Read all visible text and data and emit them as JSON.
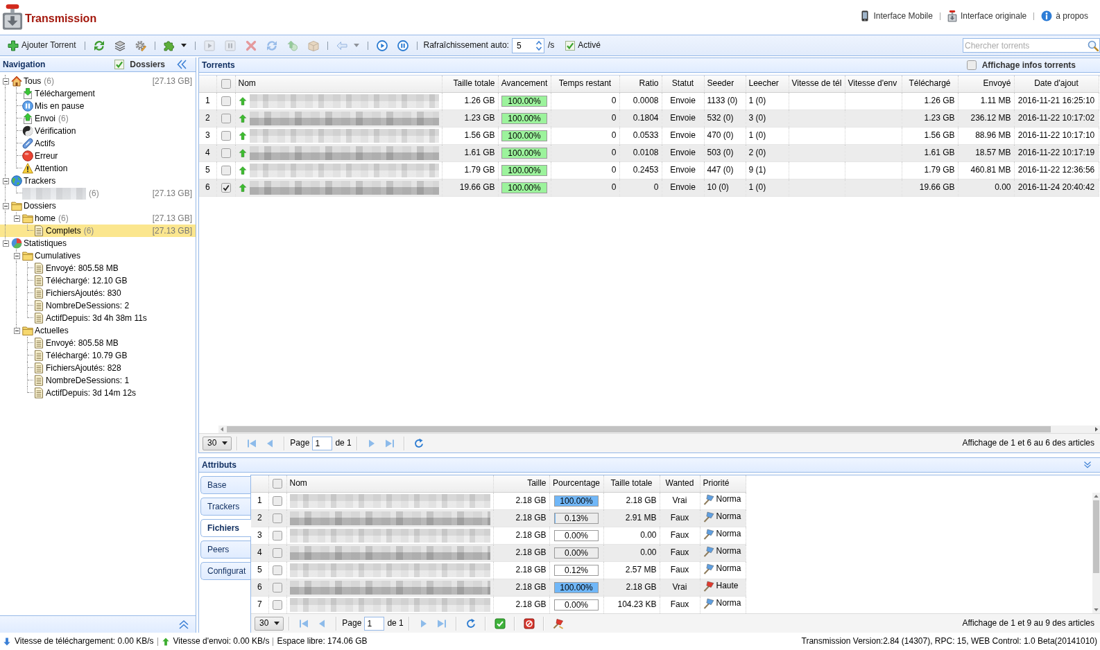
{
  "header": {
    "title": "Transmission",
    "links": [
      "Interface Mobile",
      "Interface originale",
      "à propos"
    ]
  },
  "toolbar": {
    "groups": [
      [
        {
          "kind": "button",
          "label": "Ajouter Torrent",
          "disabled": false
        }
      ],
      [
        {
          "kind": "button",
          "disabled": false
        },
        {
          "kind": "button",
          "disabled": false
        },
        {
          "kind": "button",
          "disabled": false
        }
      ],
      [
        {
          "kind": "dropdown",
          "disabled": false
        }
      ],
      [
        {
          "kind": "button",
          "disabled": true
        },
        {
          "kind": "button",
          "disabled": true
        },
        {
          "kind": "button",
          "disabled": true
        },
        {
          "kind": "button",
          "disabled": true
        },
        {
          "kind": "button",
          "disabled": true
        },
        {
          "kind": "button",
          "disabled": true
        }
      ],
      [
        {
          "kind": "dropdown",
          "disabled": true
        }
      ],
      [
        {
          "kind": "button",
          "disabled": false
        },
        {
          "kind": "button",
          "disabled": false
        }
      ]
    ],
    "refresh": {
      "label": "Rafraîchissement auto:",
      "value": "5",
      "unit": "/s"
    },
    "auto_refresh": {
      "label": "Activé",
      "checked": true
    },
    "search": {
      "placeholder": "Chercher torrents"
    }
  },
  "navigation": {
    "title": "Navigation",
    "folders_toggle": {
      "label": "Dossiers",
      "checked": true
    },
    "tree": [
      {
        "kind": "all",
        "label": "Tous",
        "count": "(6)",
        "size": "[27.13 GB]",
        "expanded": true,
        "selected": false,
        "children": [
          {
            "kind": "downloading",
            "label": "Téléchargement",
            "selected": false
          },
          {
            "kind": "paused",
            "label": "Mis en pause",
            "selected": false
          },
          {
            "kind": "seeding",
            "label": "Envoi",
            "count": "(6)",
            "selected": false
          },
          {
            "kind": "checking",
            "label": "Vérification",
            "selected": false
          },
          {
            "kind": "active",
            "label": "Actifs",
            "selected": false
          },
          {
            "kind": "error",
            "label": "Erreur",
            "selected": false
          },
          {
            "kind": "warning",
            "label": "Attention",
            "selected": false
          }
        ]
      },
      {
        "kind": "trackers",
        "label": "Trackers",
        "expanded": true,
        "selected": false,
        "children": [
          {
            "kind": "tracker",
            "count": "(6)",
            "size": "[27.13 GB]",
            "selected": false
          }
        ]
      },
      {
        "kind": "folder",
        "label": "Dossiers",
        "expanded": true,
        "selected": false,
        "children": [
          {
            "kind": "folder",
            "label": "home",
            "count": "(6)",
            "size": "[27.13 GB]",
            "expanded": true,
            "selected": false,
            "children": [
              {
                "kind": "file",
                "label": "Complets",
                "count": "(6)",
                "size": "[27.13 GB]",
                "selected": true
              }
            ]
          }
        ]
      },
      {
        "kind": "statistics",
        "label": "Statistiques",
        "expanded": true,
        "selected": false,
        "children": [
          {
            "kind": "folder",
            "label": "Cumulatives",
            "expanded": true,
            "selected": false,
            "children": [
              {
                "kind": "file",
                "label": "Envoyé: 805.58 MB",
                "selected": false
              },
              {
                "kind": "file",
                "label": "Téléchargé: 12.10 GB",
                "selected": false
              },
              {
                "kind": "file",
                "label": "FichiersAjoutés: 830",
                "selected": false
              },
              {
                "kind": "file",
                "label": "NombreDeSessions: 2",
                "selected": false
              },
              {
                "kind": "file",
                "label": "ActifDepuis: 3d 4h 38m 11s",
                "selected": false
              }
            ]
          },
          {
            "kind": "folder",
            "label": "Actuelles",
            "expanded": true,
            "selected": false,
            "children": [
              {
                "kind": "file",
                "label": "Envoyé: 805.58 MB",
                "selected": false
              },
              {
                "kind": "file",
                "label": "Téléchargé: 10.79 GB",
                "selected": false
              },
              {
                "kind": "file",
                "label": "FichiersAjoutés: 828",
                "selected": false
              },
              {
                "kind": "file",
                "label": "NombreDeSessions: 1",
                "selected": false
              },
              {
                "kind": "file",
                "label": "ActifDepuis: 3d 14m 12s",
                "selected": false
              }
            ]
          }
        ]
      }
    ]
  },
  "torrents": {
    "title": "Torrents",
    "info_toggle": {
      "label": "Affichage infos torrents",
      "checked": false
    },
    "columns": [
      "Nom",
      "Taille totale",
      "Avancement",
      "Temps restant",
      "Ratio",
      "Statut",
      "Seeder",
      "Leecher",
      "Vitesse de tél",
      "Vitesse d'env",
      "Téléchargé",
      "Envoyé",
      "Date d'ajout"
    ],
    "select_all": false,
    "rows": [
      {
        "number": "1",
        "checked": false,
        "size": "1.26 GB",
        "progress": "100.00%",
        "level": 1,
        "remaining": "0",
        "ratio": "0.0008",
        "status": "Envoie",
        "seeder": "1133 (0)",
        "leecher": "1 (0)",
        "downloaded": "1.26 GB",
        "uploaded": "1.11 MB",
        "added": "2016-11-21 16:25:10"
      },
      {
        "number": "2",
        "checked": false,
        "size": "1.23 GB",
        "progress": "100.00%",
        "level": 1,
        "remaining": "0",
        "ratio": "0.1804",
        "status": "Envoie",
        "seeder": "532 (0)",
        "leecher": "3 (0)",
        "downloaded": "1.23 GB",
        "uploaded": "236.12 MB",
        "added": "2016-11-22 10:17:02"
      },
      {
        "number": "3",
        "checked": false,
        "size": "1.56 GB",
        "progress": "100.00%",
        "level": 1,
        "remaining": "0",
        "ratio": "0.0533",
        "status": "Envoie",
        "seeder": "470 (0)",
        "leecher": "1 (0)",
        "downloaded": "1.56 GB",
        "uploaded": "88.96 MB",
        "added": "2016-11-22 10:17:10"
      },
      {
        "number": "4",
        "checked": false,
        "size": "1.61 GB",
        "progress": "100.00%",
        "level": 1,
        "remaining": "0",
        "ratio": "0.0108",
        "status": "Envoie",
        "seeder": "503 (0)",
        "leecher": "2 (0)",
        "downloaded": "1.61 GB",
        "uploaded": "18.57 MB",
        "added": "2016-11-22 10:17:19"
      },
      {
        "number": "5",
        "checked": false,
        "size": "1.79 GB",
        "progress": "100.00%",
        "level": 1,
        "remaining": "0",
        "ratio": "0.2453",
        "status": "Envoie",
        "seeder": "447 (0)",
        "leecher": "9 (1)",
        "downloaded": "1.79 GB",
        "uploaded": "460.81 MB",
        "added": "2016-11-22 12:36:56"
      },
      {
        "number": "6",
        "checked": true,
        "size": "19.66 GB",
        "progress": "100.00%",
        "level": 1,
        "remaining": "0",
        "ratio": "0",
        "status": "Envoie",
        "seeder": "10 (0)",
        "leecher": "1 (0)",
        "downloaded": "19.66 GB",
        "uploaded": "0.00",
        "added": "2016-11-24 20:40:42"
      }
    ],
    "pager": {
      "page_size": "30",
      "page_label": "Page",
      "page": "1",
      "page_count": "de 1",
      "summary": "Affichage de 1 et 6 au 6 des articles"
    }
  },
  "attributes": {
    "title": "Attributs",
    "tabs": [
      {
        "label": "Base",
        "selected": false
      },
      {
        "label": "Trackers",
        "selected": false
      },
      {
        "label": "Fichiers",
        "selected": true
      },
      {
        "label": "Peers",
        "selected": false
      },
      {
        "label": "Configurat",
        "selected": false
      }
    ],
    "columns": [
      "Nom",
      "Taille",
      "Pourcentage",
      "Taille totale",
      "Wanted",
      "Priorité"
    ],
    "select_all": false,
    "rows": [
      {
        "number": "1",
        "checked": false,
        "size": "2.18 GB",
        "percent": "100.00%",
        "level": 1,
        "total": "2.18 GB",
        "wanted": "Vrai",
        "priority": "Norma",
        "color": "#5f9fe0"
      },
      {
        "number": "2",
        "checked": false,
        "size": "2.18 GB",
        "percent": "0.13%",
        "level": 0.0013,
        "total": "2.91 MB",
        "wanted": "Faux",
        "priority": "Norma",
        "color": "#5f9fe0"
      },
      {
        "number": "3",
        "checked": false,
        "size": "2.18 GB",
        "percent": "0.00%",
        "level": 0,
        "total": "0.00",
        "wanted": "Faux",
        "priority": "Norma",
        "color": "#5f9fe0"
      },
      {
        "number": "4",
        "checked": false,
        "size": "2.18 GB",
        "percent": "0.00%",
        "level": 0,
        "total": "0.00",
        "wanted": "Faux",
        "priority": "Norma",
        "color": "#5f9fe0"
      },
      {
        "number": "5",
        "checked": false,
        "size": "2.18 GB",
        "percent": "0.12%",
        "level": 0.0012,
        "total": "2.57 MB",
        "wanted": "Faux",
        "priority": "Norma",
        "color": "#5f9fe0"
      },
      {
        "number": "6",
        "checked": false,
        "size": "2.18 GB",
        "percent": "100.00%",
        "level": 1,
        "total": "2.18 GB",
        "wanted": "Vrai",
        "priority": "Haute",
        "color": "#e03a2e"
      },
      {
        "number": "7",
        "checked": false,
        "size": "2.18 GB",
        "percent": "0.00%",
        "level": 0,
        "total": "104.23 KB",
        "wanted": "Faux",
        "priority": "Norma",
        "color": "#5f9fe0"
      }
    ],
    "pager": {
      "page_size": "30",
      "page_label": "Page",
      "page": "1",
      "page_count": "de 1",
      "summary": "Affichage de 1 et 9 au 9 des articles"
    }
  },
  "status_bar": {
    "download": "Vitesse de téléchargement: 0.00 KB/s",
    "upload": "Vitesse d'envoi: 0.00 KB/s",
    "free": "Espace libre: 174.06 GB",
    "version": "Transmission Version:2.84 (14307), RPC: 15, WEB Control: 1.0 Beta(20141010)"
  }
}
